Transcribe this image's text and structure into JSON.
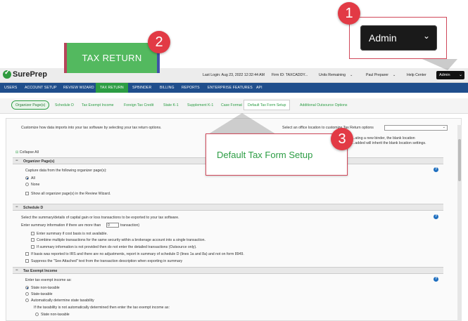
{
  "header": {
    "logo_text": "SurePrep",
    "last_login": "Last Login:  Aug 23, 2022 12:32:44 AM",
    "firm_id": "Firm ID:    TAXCADDY...",
    "units_remaining": "Units Remaining",
    "user_name": "Paul Preparer",
    "help_center": "Help Center",
    "admin_label": "Admin"
  },
  "main_nav": {
    "items": [
      "USERS",
      "ACCOUNT SETUP",
      "REVIEW WIZARD",
      "TAX RETURN",
      "SPBINDER",
      "BILLING",
      "REPORTS",
      "ENTERPRISE FEATURES",
      "API"
    ],
    "active": "TAX RETURN"
  },
  "sub_tabs": {
    "items": [
      "Organizer Page(s)",
      "Schedule D",
      "Tax Exempt Income",
      "Foreign Tax Credit",
      "State K-1",
      "Supplement K-1",
      "Case Format",
      "Default Tax Form Setup",
      "Additional Outsource Options"
    ]
  },
  "content": {
    "intro": "Customize how data imports into your tax software by selecting your tax return options.",
    "office_location": "Select an office location to customize Tax Return options",
    "note_line1": "...ating a new binder, the blank location",
    "note_line2": "...added will inherit the blank location settings.",
    "collapse_all": "Collapse All",
    "organizer": {
      "title": "Organizer Page(s)",
      "prompt": "Capture data from the following organizer page(s):",
      "opt_all": "All",
      "opt_none": "None",
      "show_all": "Show all organizer page(s) in the Review Wizard."
    },
    "schedule_d": {
      "title": "Schedule D",
      "line1": "Select the summary/details of capital gain or loss transactions to be exported to your tax software.",
      "line2_pre": "Enter summary information if there are more than",
      "line2_value": "0",
      "line2_post": "transaction)",
      "opt1": "Enter summary if cost basis is not available.",
      "opt2": "Combine multiple transactions for the same security within a brokerage account into a single transaction.",
      "opt3": "If summary information is not provided then do not enter the detailed transactions (Outsource only).",
      "opt4": "If basis was reported to IRS and there are no adjustments, report in summary of schedule D (lines 1a and 8a) and not on form 8949.",
      "opt5": "Suppress the \"See Attached\" text from the transaction description when exporting in summary"
    },
    "tax_exempt": {
      "title": "Tax Exempt Income",
      "prompt": "Enter tax exempt income as:",
      "opt1": "State non-taxable",
      "opt2": "State-taxable",
      "opt3": "Automatically determine state taxability",
      "sub_prompt": "If the taxability is not automatically determined then enter the tax exempt income as:",
      "sub_opt1": "State non-taxable"
    }
  },
  "callouts": {
    "one": "1",
    "two": "2",
    "three": "3",
    "admin": "Admin",
    "tax_return": "TAX RETURN",
    "default_tax_form": "Default Tax Form Setup"
  },
  "colors": {
    "nav_blue": "#1f4e8c",
    "accent_green": "#2c9d44",
    "badge_red": "#e23a45"
  }
}
